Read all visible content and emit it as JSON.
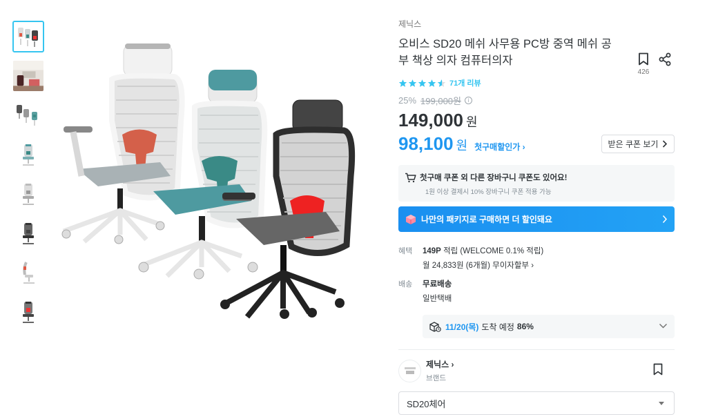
{
  "product": {
    "brand": "제닉스",
    "title": "오비스 SD20 메쉬 사무용 PC방 중역 메쉬 공부 책상 의자 컴퓨터의자",
    "scrap_count": "426",
    "rating": 4.5,
    "review_label": "71개 리뷰",
    "discount": "25%",
    "original_price": "199,000원",
    "price": "149,000",
    "price_unit": "원",
    "coupon_price": "98,100",
    "coupon_unit": "원",
    "first_purchase_label": "첫구매할인가 ›",
    "coupon_button": "받은 쿠폰 보기"
  },
  "notice": {
    "title": "첫구매 쿠폰 외 다른 장바구니 쿠폰도 있어요!",
    "subtitle": "1원 이상 결제시 10% 장바구니 쿠폰 적용 가능"
  },
  "package_banner": {
    "text": "나만의 패키지로 구매하면 더 할인돼요"
  },
  "benefit": {
    "label": "혜택",
    "points": "149P",
    "points_text": "적립 (WELCOME 0.1% 적립)",
    "installment": "월 24,833원 (6개월) 무이자할부 ›"
  },
  "shipping": {
    "label": "배송",
    "fee": "무료배송",
    "type": "일반택배",
    "eta_date": "11/20(목)",
    "eta_text": "도착 예정",
    "eta_percent": "86%"
  },
  "brand_section": {
    "name": "제닉스 ›",
    "sub": "브랜드"
  },
  "option_select": {
    "value": "SD20체어"
  },
  "thumbnails": [
    "thumb-three-chairs",
    "thumb-lifestyle",
    "thumb-multi-angle",
    "thumb-teal-chair",
    "thumb-gray-chair",
    "thumb-black-chair",
    "thumb-side-chair",
    "thumb-red-chair"
  ],
  "colors": {
    "accent": "#35c5f0",
    "price_blue": "#1e96f0",
    "text": "#2f3438",
    "muted": "#828c94"
  }
}
